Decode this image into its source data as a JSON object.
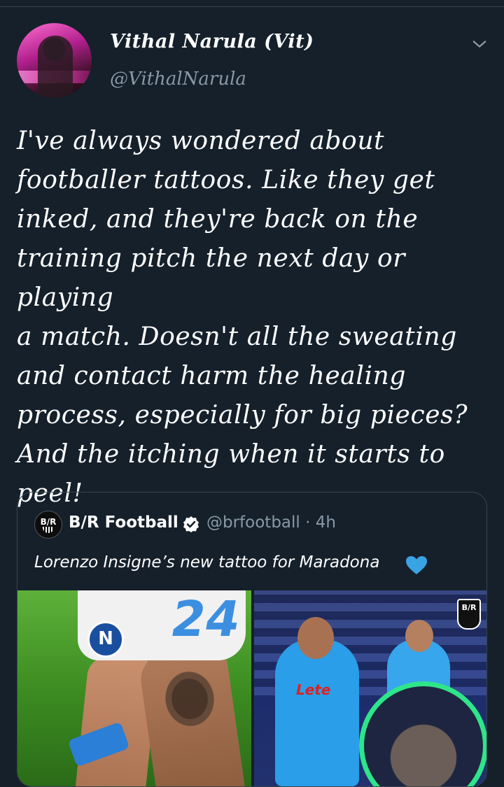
{
  "tweet": {
    "author_name": "Vithal Narula (Vit)",
    "author_handle": "@VithalNarula",
    "text": "I've always wondered about\nfootballer tattoos. Like they get\ninked, and they're back on the\ntraining pitch the next day or playing\na match. Doesn't all the sweating\nand contact harm the healing\nprocess, especially for big pieces?\nAnd the itching when it starts to\npeel!"
  },
  "quoted_tweet": {
    "author_name": "B/R Football",
    "author_handle": "@brfootball · 4h",
    "avatar_label": "B/R",
    "text": "Lorenzo Insigne’s new tattoo for Maradona",
    "left_image": {
      "jersey_number": "24",
      "badge_letter": "N"
    },
    "right_image": {
      "sponsor": "Lete",
      "logo_label": "B/R"
    }
  },
  "colors": {
    "background": "#15202b",
    "secondary_text": "#8899a6",
    "border": "#38444d",
    "heart": "#3aa3e3",
    "verified": "#ffffff"
  },
  "icons": {
    "menu": "chevron-down-icon",
    "verified": "verified-badge-icon",
    "heart": "blue-heart-icon"
  }
}
